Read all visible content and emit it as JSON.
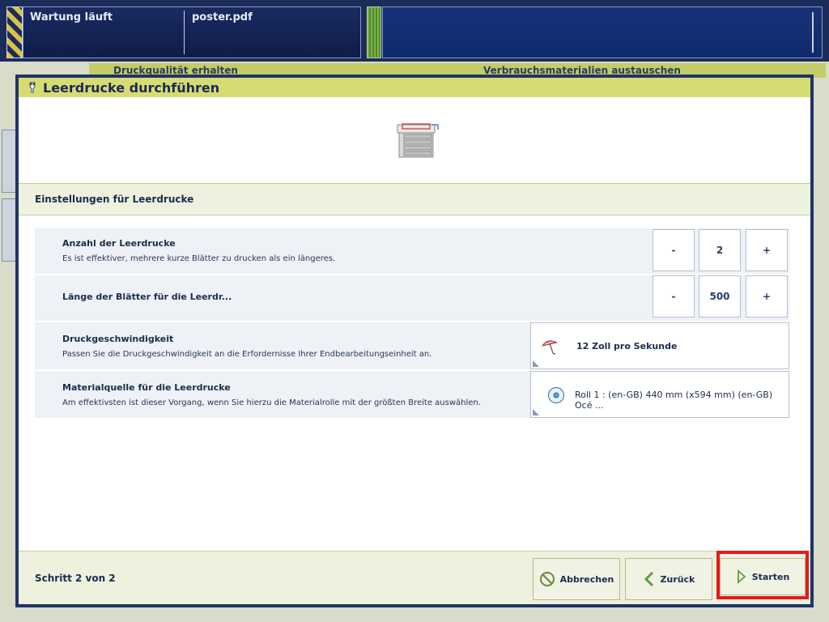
{
  "status_bar": {
    "status_text": "Wartung läuft",
    "file_name": "poster.pdf"
  },
  "background": {
    "tab_left": "Druckqualität erhalten",
    "tab_right": "Verbrauchsmaterialien austauschen"
  },
  "dialog": {
    "title": "Leerdrucke durchführen",
    "section_title": "Einstellungen für Leerdrucke",
    "settings": {
      "count": {
        "label": "Anzahl der Leerdrucke",
        "description": "Es ist effektiver, mehrere kurze Blätter zu drucken als ein längeres.",
        "minus": "-",
        "value": "2",
        "plus": "+"
      },
      "length": {
        "label": "Länge der Blätter für die Leerdr...",
        "minus": "-",
        "value": "500",
        "plus": "+"
      },
      "speed": {
        "label": "Druckgeschwindigkeit",
        "description": "Passen Sie die Druckgeschwindigkeit an die Erfordernisse Ihrer Endbearbeitungseinheit an.",
        "value": "12 Zoll pro Sekunde",
        "icon": "umbrella-icon"
      },
      "media": {
        "label": "Materialquelle für die Leerdrucke",
        "description": "Am effektivsten ist dieser Vorgang, wenn Sie hierzu die Materialrolle mit der größten Breite auswählen.",
        "value": "Roll 1 : (en-GB) 440 mm (x594 mm) (en-GB) Océ ...",
        "icon": "roll-icon"
      }
    },
    "footer": {
      "step": "Schritt 2 von 2",
      "cancel": "Abbrechen",
      "back": "Zurück",
      "start": "Starten"
    }
  },
  "colors": {
    "title_bar": "#d6dc72",
    "dialog_frame": "#1e3566",
    "highlight": "#e31b1b"
  }
}
